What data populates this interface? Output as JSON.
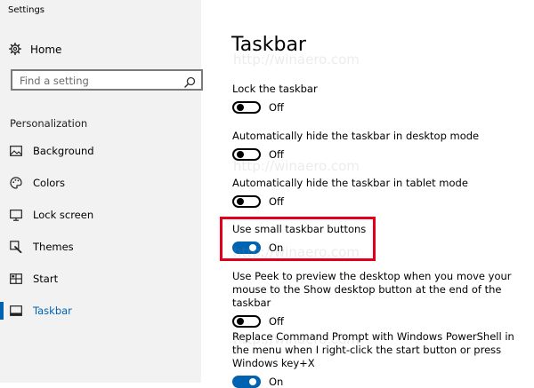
{
  "window": {
    "title": "Settings"
  },
  "sidebar": {
    "home_label": "Home",
    "search_placeholder": "Find a setting",
    "section_title": "Personalization",
    "items": [
      {
        "label": "Background",
        "icon": "picture-icon"
      },
      {
        "label": "Colors",
        "icon": "palette-icon"
      },
      {
        "label": "Lock screen",
        "icon": "monitor-icon"
      },
      {
        "label": "Themes",
        "icon": "brush-icon"
      },
      {
        "label": "Start",
        "icon": "start-grid-icon"
      },
      {
        "label": "Taskbar",
        "icon": "taskbar-icon",
        "active": true
      }
    ]
  },
  "main": {
    "title": "Taskbar",
    "settings": [
      {
        "label": "Lock the taskbar",
        "state": "Off",
        "on": false
      },
      {
        "label": "Automatically hide the taskbar in desktop mode",
        "state": "Off",
        "on": false
      },
      {
        "label": "Automatically hide the taskbar in tablet mode",
        "state": "Off",
        "on": false
      },
      {
        "label": "Use small taskbar buttons",
        "state": "On",
        "on": true,
        "highlighted": true
      },
      {
        "label": "Use Peek to preview the desktop when you move your mouse to the Show desktop button at the end of the taskbar",
        "state": "Off",
        "on": false
      },
      {
        "label": "Replace Command Prompt with Windows PowerShell in the menu when I right-click the start button or press Windows key+X",
        "state": "On",
        "on": true
      }
    ]
  },
  "watermark": "http://winaero.com",
  "colors": {
    "accent": "#0063b1",
    "highlight": "#e0001a",
    "sidebar_bg": "#f2f2f2"
  }
}
